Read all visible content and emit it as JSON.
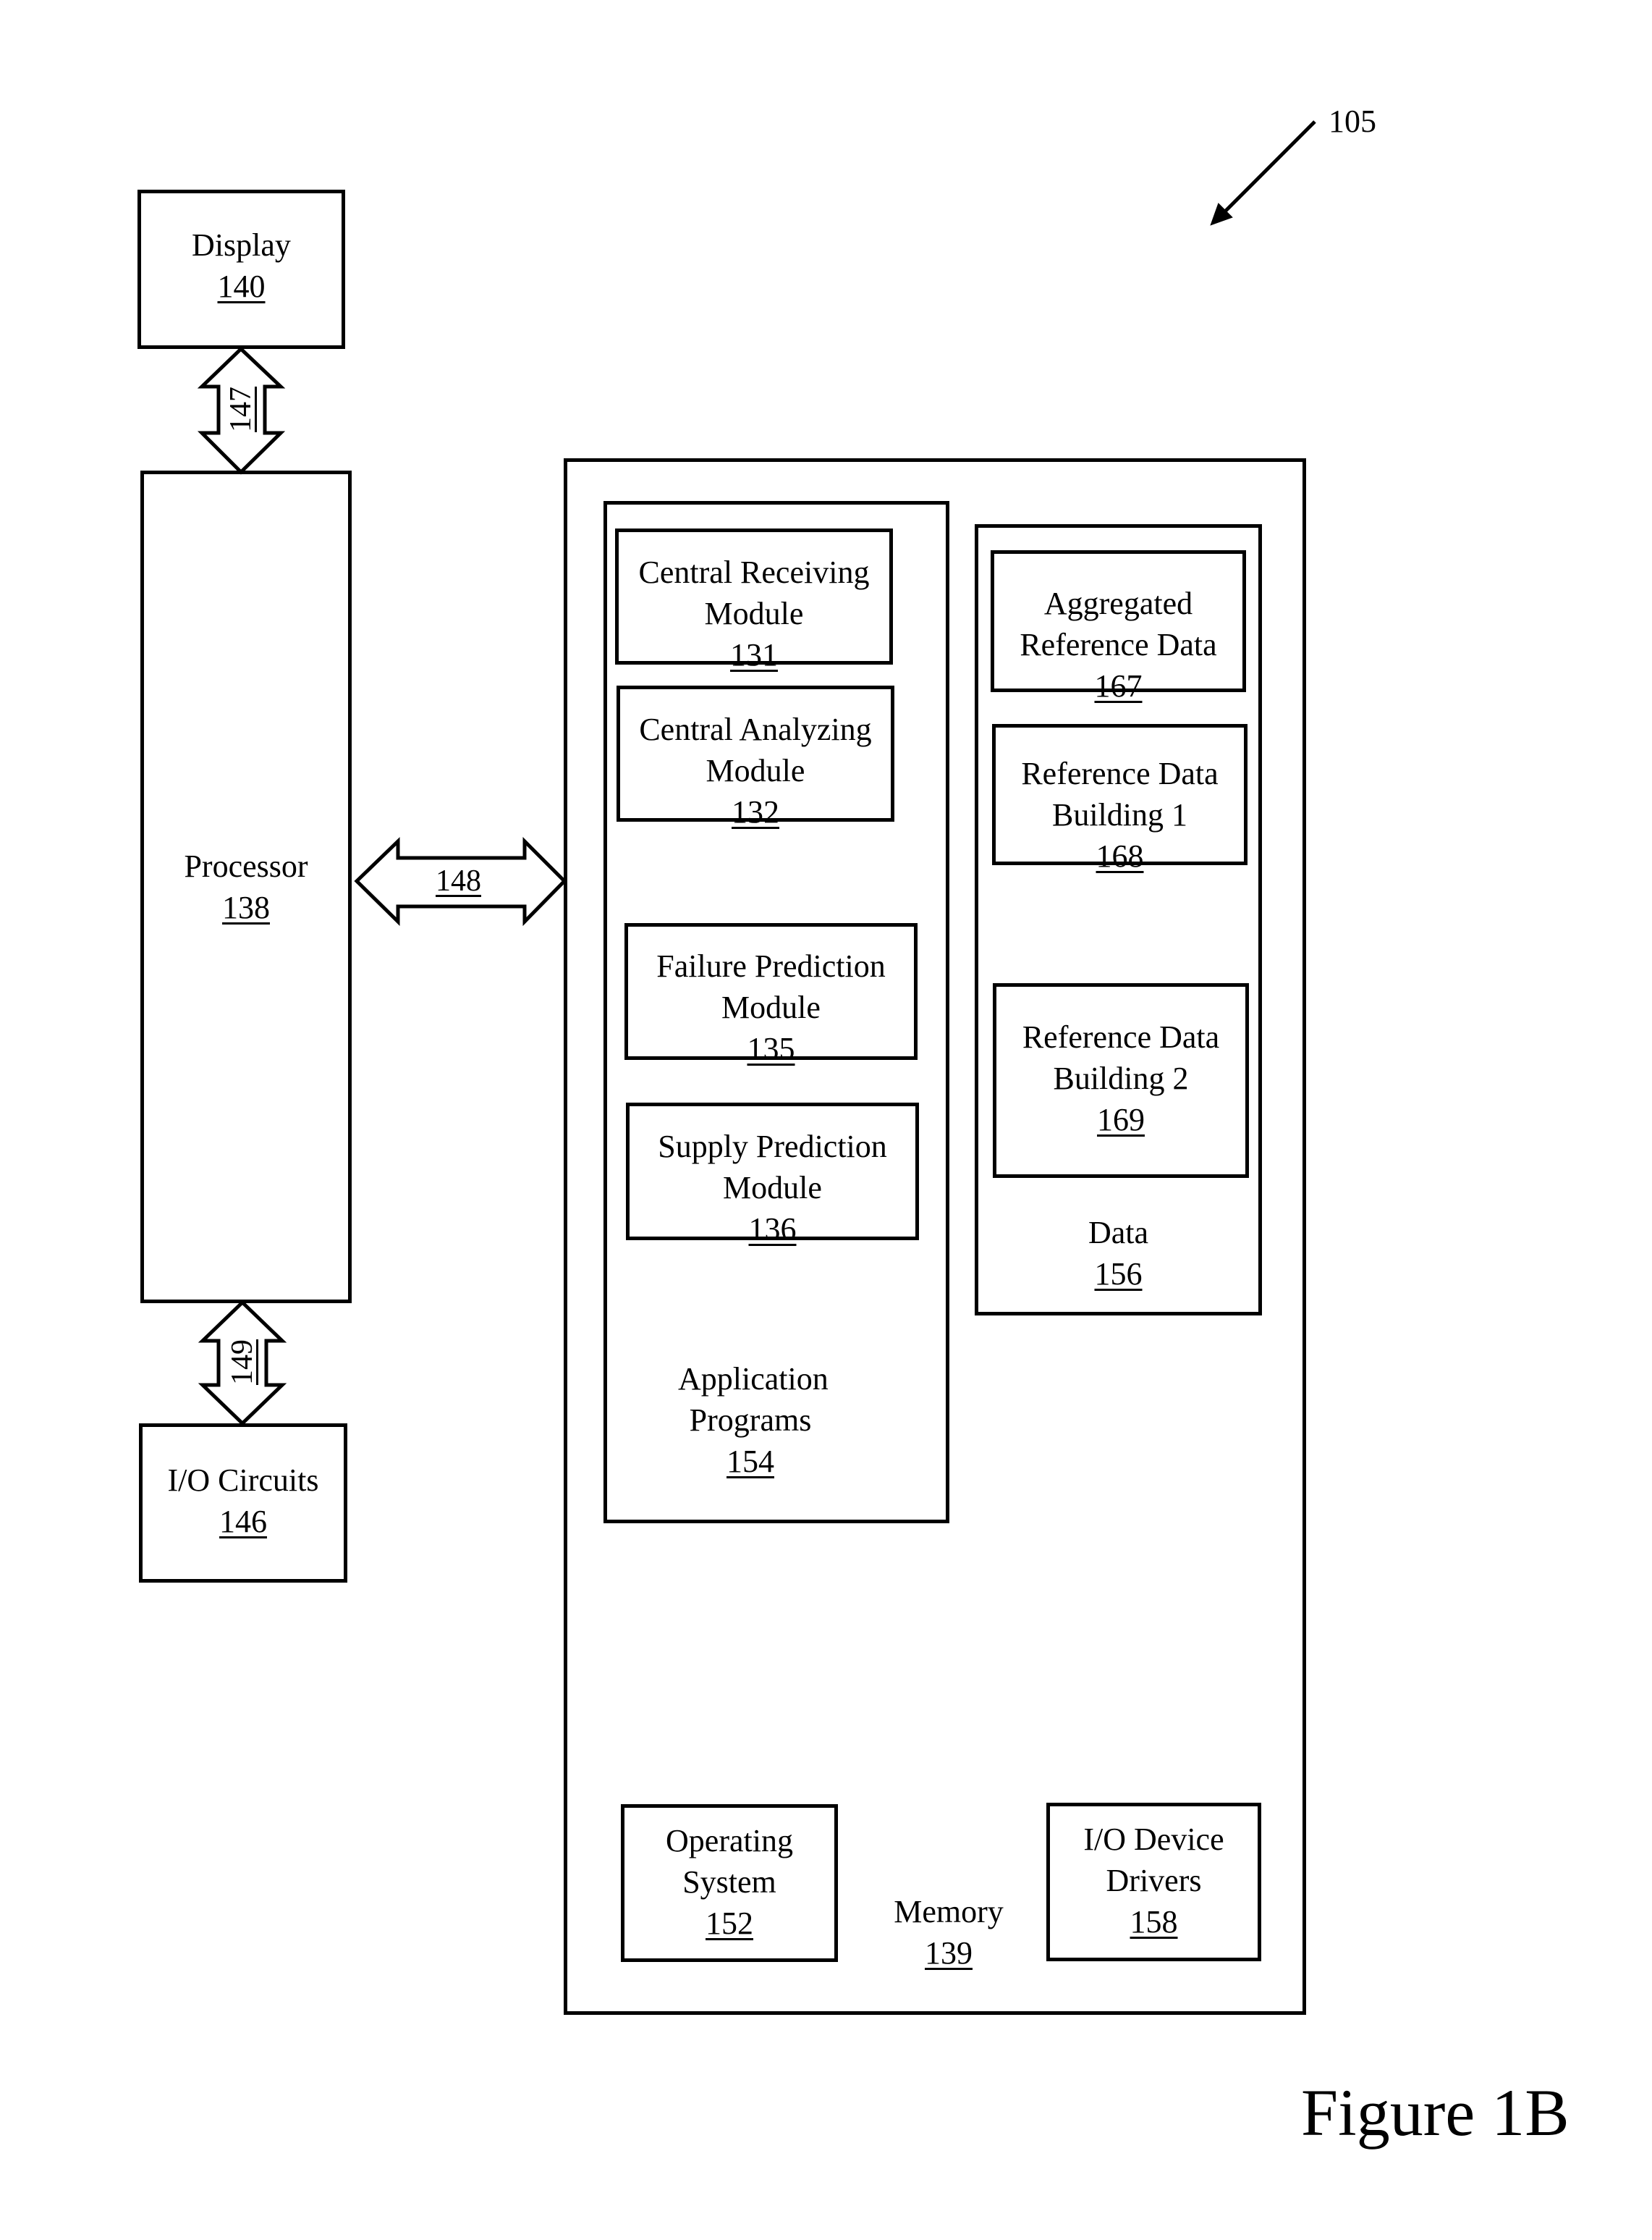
{
  "figure": {
    "caption": "Figure 1B",
    "system_ref": "105"
  },
  "components": {
    "display": {
      "name": "Display",
      "ref": "140"
    },
    "processor": {
      "name": "Processor",
      "ref": "138"
    },
    "io_circuits": {
      "name": "I/O Circuits",
      "ref": "146"
    },
    "memory": {
      "name": "Memory",
      "ref": "139",
      "application_programs": {
        "name_line1": "Application",
        "name_line2": "Programs",
        "ref": "154",
        "modules": [
          {
            "line1": "Central Receiving",
            "line2": "Module",
            "ref": "131"
          },
          {
            "line1": "Central Analyzing",
            "line2": "Module",
            "ref": "132"
          },
          {
            "line1": "Failure Prediction",
            "line2": "Module",
            "ref": "135"
          },
          {
            "line1": "Supply Prediction",
            "line2": "Module",
            "ref": "136"
          }
        ]
      },
      "data": {
        "name": "Data",
        "ref": "156",
        "items": [
          {
            "line1": "Aggregated",
            "line2": "Reference Data",
            "ref": "167"
          },
          {
            "line1": "Reference Data",
            "line2": "Building 1",
            "ref": "168"
          },
          {
            "line1": "Reference Data",
            "line2": "Building 2",
            "ref": "169"
          }
        ]
      },
      "operating_system": {
        "line1": "Operating",
        "line2": "System",
        "ref": "152"
      },
      "io_device_drivers": {
        "line1": "I/O Device",
        "line2": "Drivers",
        "ref": "158"
      }
    }
  },
  "connections": [
    {
      "ref": "147",
      "from": "Display",
      "to": "Processor",
      "type": "bidirectional"
    },
    {
      "ref": "148",
      "from": "Processor",
      "to": "Memory",
      "type": "bidirectional"
    },
    {
      "ref": "149",
      "from": "Processor",
      "to": "I/O Circuits",
      "type": "bidirectional"
    }
  ]
}
